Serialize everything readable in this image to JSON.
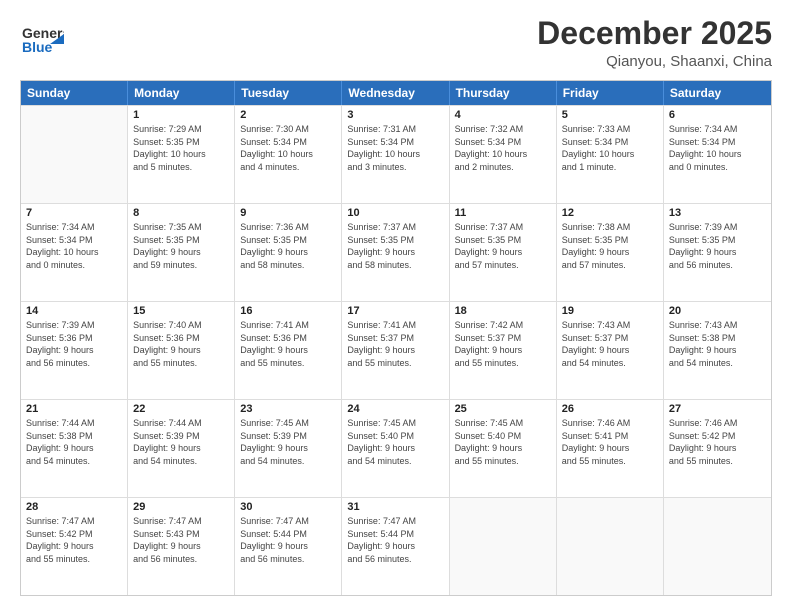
{
  "header": {
    "logo_line1": "General",
    "logo_line2": "Blue",
    "month": "December 2025",
    "location": "Qianyou, Shaanxi, China"
  },
  "days_of_week": [
    "Sunday",
    "Monday",
    "Tuesday",
    "Wednesday",
    "Thursday",
    "Friday",
    "Saturday"
  ],
  "weeks": [
    [
      {
        "day": "",
        "info": ""
      },
      {
        "day": "1",
        "info": "Sunrise: 7:29 AM\nSunset: 5:35 PM\nDaylight: 10 hours\nand 5 minutes."
      },
      {
        "day": "2",
        "info": "Sunrise: 7:30 AM\nSunset: 5:34 PM\nDaylight: 10 hours\nand 4 minutes."
      },
      {
        "day": "3",
        "info": "Sunrise: 7:31 AM\nSunset: 5:34 PM\nDaylight: 10 hours\nand 3 minutes."
      },
      {
        "day": "4",
        "info": "Sunrise: 7:32 AM\nSunset: 5:34 PM\nDaylight: 10 hours\nand 2 minutes."
      },
      {
        "day": "5",
        "info": "Sunrise: 7:33 AM\nSunset: 5:34 PM\nDaylight: 10 hours\nand 1 minute."
      },
      {
        "day": "6",
        "info": "Sunrise: 7:34 AM\nSunset: 5:34 PM\nDaylight: 10 hours\nand 0 minutes."
      }
    ],
    [
      {
        "day": "7",
        "info": "Sunrise: 7:34 AM\nSunset: 5:34 PM\nDaylight: 10 hours\nand 0 minutes."
      },
      {
        "day": "8",
        "info": "Sunrise: 7:35 AM\nSunset: 5:35 PM\nDaylight: 9 hours\nand 59 minutes."
      },
      {
        "day": "9",
        "info": "Sunrise: 7:36 AM\nSunset: 5:35 PM\nDaylight: 9 hours\nand 58 minutes."
      },
      {
        "day": "10",
        "info": "Sunrise: 7:37 AM\nSunset: 5:35 PM\nDaylight: 9 hours\nand 58 minutes."
      },
      {
        "day": "11",
        "info": "Sunrise: 7:37 AM\nSunset: 5:35 PM\nDaylight: 9 hours\nand 57 minutes."
      },
      {
        "day": "12",
        "info": "Sunrise: 7:38 AM\nSunset: 5:35 PM\nDaylight: 9 hours\nand 57 minutes."
      },
      {
        "day": "13",
        "info": "Sunrise: 7:39 AM\nSunset: 5:35 PM\nDaylight: 9 hours\nand 56 minutes."
      }
    ],
    [
      {
        "day": "14",
        "info": "Sunrise: 7:39 AM\nSunset: 5:36 PM\nDaylight: 9 hours\nand 56 minutes."
      },
      {
        "day": "15",
        "info": "Sunrise: 7:40 AM\nSunset: 5:36 PM\nDaylight: 9 hours\nand 55 minutes."
      },
      {
        "day": "16",
        "info": "Sunrise: 7:41 AM\nSunset: 5:36 PM\nDaylight: 9 hours\nand 55 minutes."
      },
      {
        "day": "17",
        "info": "Sunrise: 7:41 AM\nSunset: 5:37 PM\nDaylight: 9 hours\nand 55 minutes."
      },
      {
        "day": "18",
        "info": "Sunrise: 7:42 AM\nSunset: 5:37 PM\nDaylight: 9 hours\nand 55 minutes."
      },
      {
        "day": "19",
        "info": "Sunrise: 7:43 AM\nSunset: 5:37 PM\nDaylight: 9 hours\nand 54 minutes."
      },
      {
        "day": "20",
        "info": "Sunrise: 7:43 AM\nSunset: 5:38 PM\nDaylight: 9 hours\nand 54 minutes."
      }
    ],
    [
      {
        "day": "21",
        "info": "Sunrise: 7:44 AM\nSunset: 5:38 PM\nDaylight: 9 hours\nand 54 minutes."
      },
      {
        "day": "22",
        "info": "Sunrise: 7:44 AM\nSunset: 5:39 PM\nDaylight: 9 hours\nand 54 minutes."
      },
      {
        "day": "23",
        "info": "Sunrise: 7:45 AM\nSunset: 5:39 PM\nDaylight: 9 hours\nand 54 minutes."
      },
      {
        "day": "24",
        "info": "Sunrise: 7:45 AM\nSunset: 5:40 PM\nDaylight: 9 hours\nand 54 minutes."
      },
      {
        "day": "25",
        "info": "Sunrise: 7:45 AM\nSunset: 5:40 PM\nDaylight: 9 hours\nand 55 minutes."
      },
      {
        "day": "26",
        "info": "Sunrise: 7:46 AM\nSunset: 5:41 PM\nDaylight: 9 hours\nand 55 minutes."
      },
      {
        "day": "27",
        "info": "Sunrise: 7:46 AM\nSunset: 5:42 PM\nDaylight: 9 hours\nand 55 minutes."
      }
    ],
    [
      {
        "day": "28",
        "info": "Sunrise: 7:47 AM\nSunset: 5:42 PM\nDaylight: 9 hours\nand 55 minutes."
      },
      {
        "day": "29",
        "info": "Sunrise: 7:47 AM\nSunset: 5:43 PM\nDaylight: 9 hours\nand 56 minutes."
      },
      {
        "day": "30",
        "info": "Sunrise: 7:47 AM\nSunset: 5:44 PM\nDaylight: 9 hours\nand 56 minutes."
      },
      {
        "day": "31",
        "info": "Sunrise: 7:47 AM\nSunset: 5:44 PM\nDaylight: 9 hours\nand 56 minutes."
      },
      {
        "day": "",
        "info": ""
      },
      {
        "day": "",
        "info": ""
      },
      {
        "day": "",
        "info": ""
      }
    ]
  ]
}
